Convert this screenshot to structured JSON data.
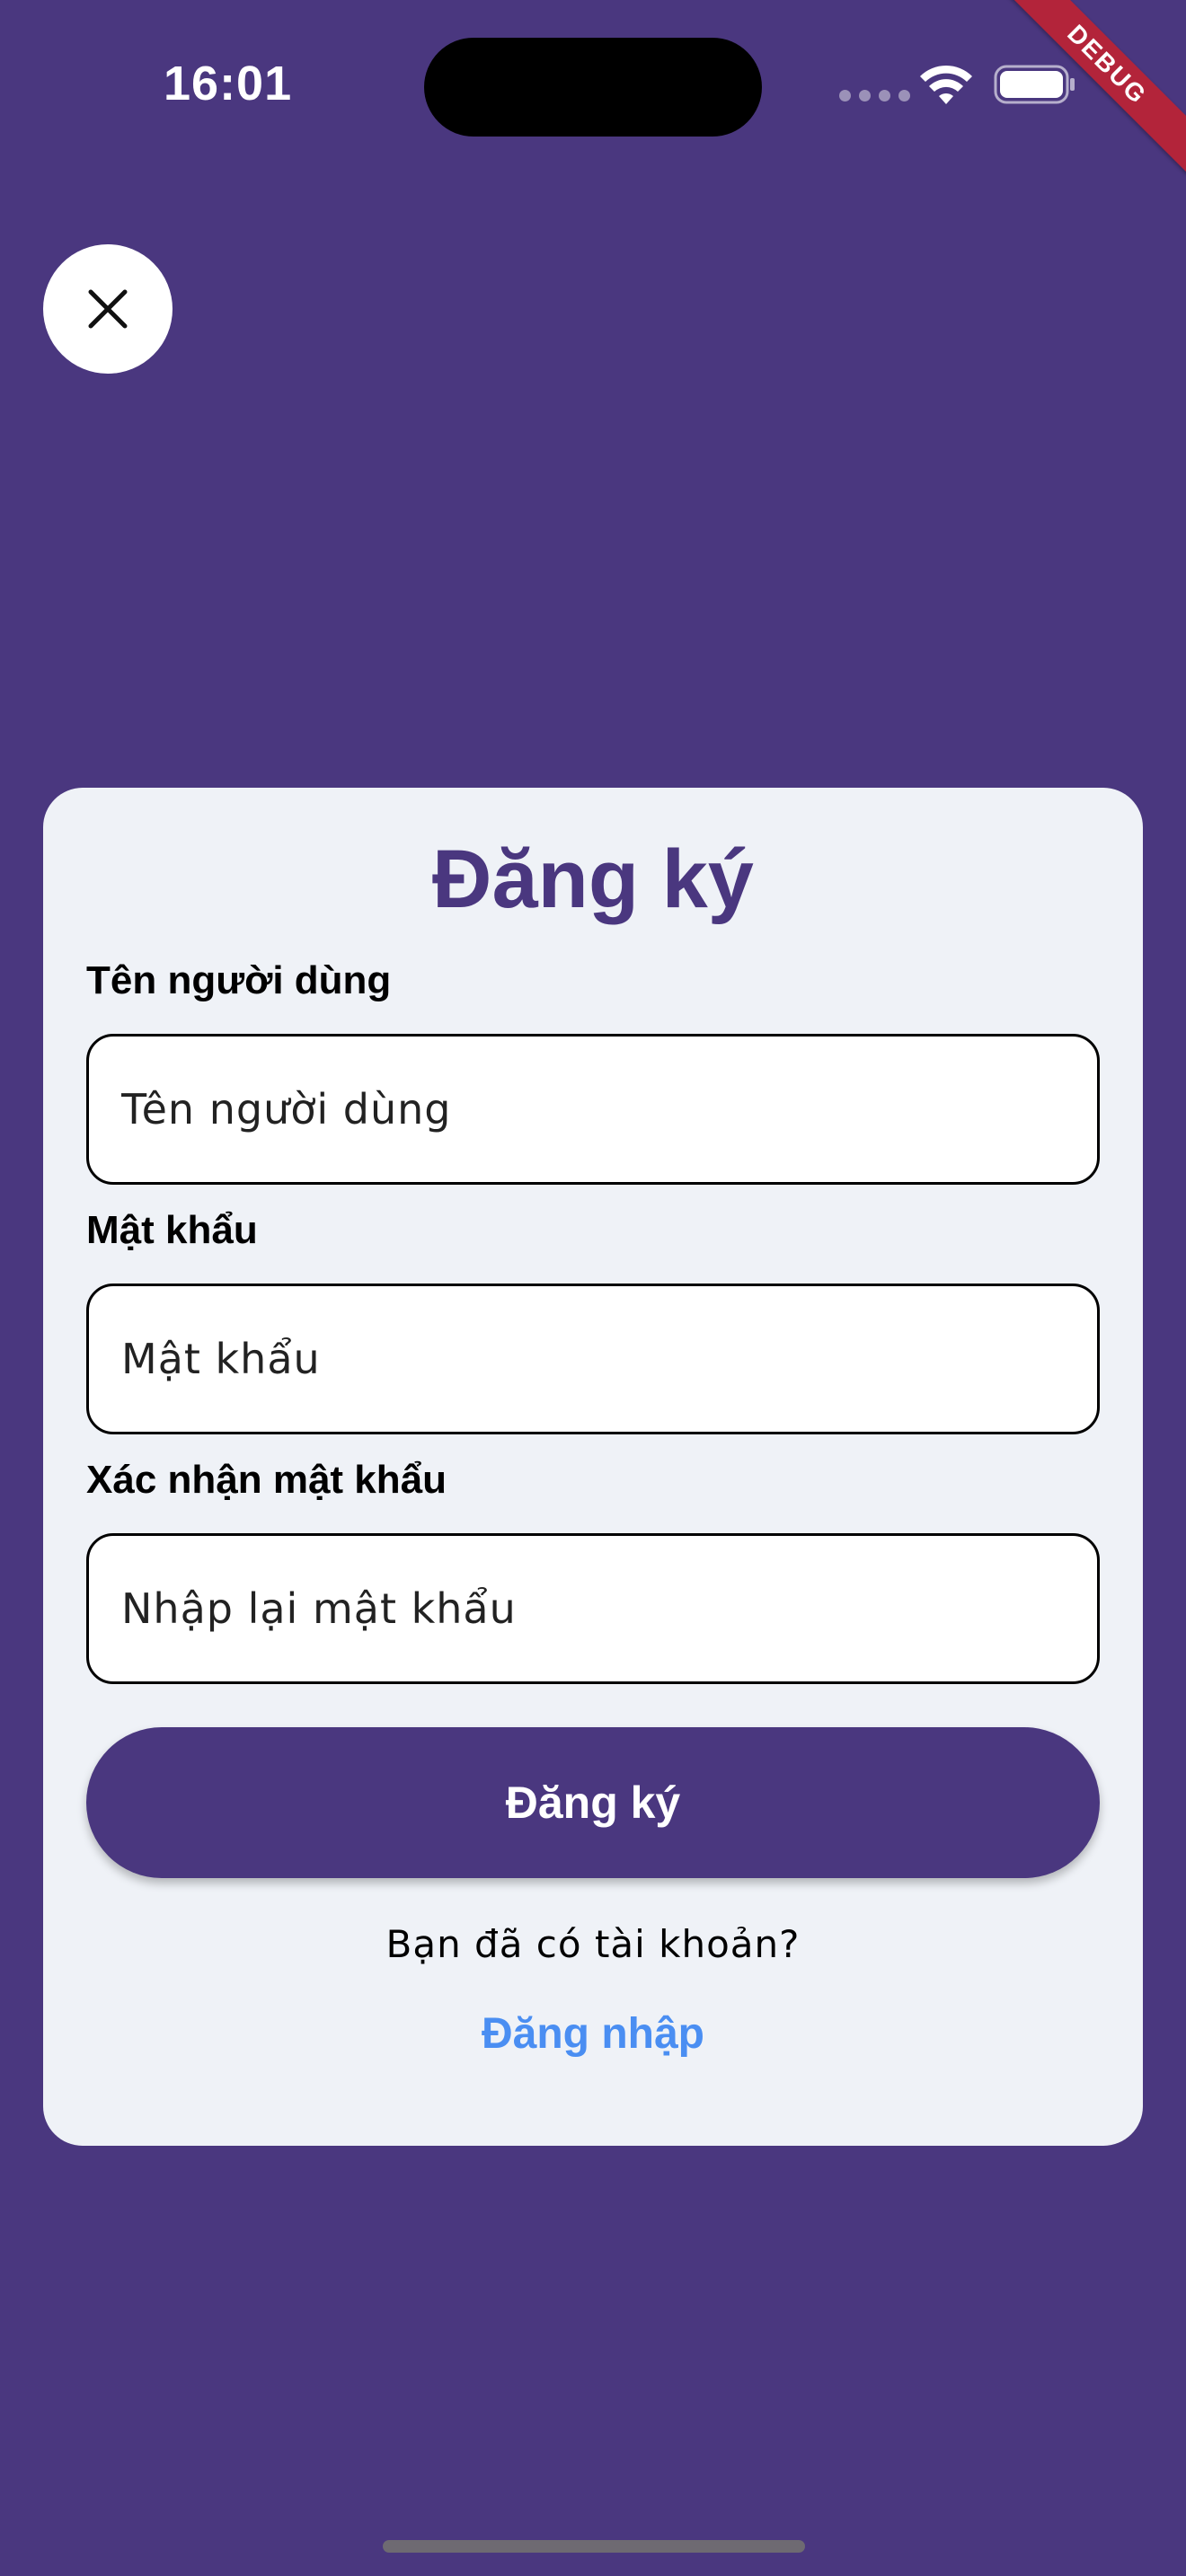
{
  "status_bar": {
    "time": "16:01",
    "debug_label": "DEBUG"
  },
  "icons": {
    "close": "close-icon",
    "wifi": "wifi-icon",
    "battery": "battery-icon",
    "signal": "cellular-signal-icon"
  },
  "colors": {
    "background": "#4a377f",
    "card": "#eff2f7",
    "primary": "#4a377f",
    "link": "#4a8ef2",
    "debug_ribbon": "#b3243a"
  },
  "form": {
    "title": "Đăng ký",
    "username": {
      "label": "Tên người dùng",
      "placeholder": "Tên người dùng",
      "value": ""
    },
    "password": {
      "label": "Mật khẩu",
      "placeholder": "Mật khẩu",
      "value": ""
    },
    "confirm_password": {
      "label": "Xác nhận mật khẩu",
      "placeholder": "Nhập lại mật khẩu",
      "value": ""
    },
    "submit_label": "Đăng ký",
    "have_account_prompt": "Bạn đã có tài khoản?",
    "login_link": "Đăng nhập"
  }
}
